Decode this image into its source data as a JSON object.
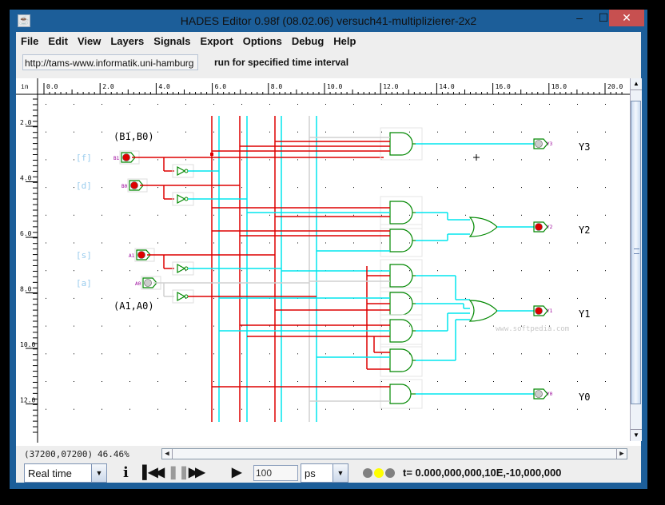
{
  "window": {
    "title": "HADES Editor 0.98f (08.02.06)   versuch41-multiplizierer-2x2",
    "controls": {
      "minimize": "‒",
      "maximize": "☐",
      "close": "✕"
    }
  },
  "menu": [
    "File",
    "Edit",
    "View",
    "Layers",
    "Signals",
    "Export",
    "Options",
    "Debug",
    "Help"
  ],
  "urlbar": {
    "url": "http://tams-www.informatik.uni-hamburg",
    "run_label": "run for specified time interval"
  },
  "ruler": {
    "unit": "in",
    "x_ticks": [
      "0.0",
      "2.0",
      "4.0",
      "6.0",
      "8.0",
      "10.0",
      "12.0",
      "14.0",
      "16.0",
      "18.0",
      "20.0"
    ],
    "y_ticks": [
      "2.0",
      "4.0",
      "6.0",
      "8.0",
      "10.0",
      "12.0"
    ]
  },
  "schematic": {
    "group_labels": {
      "b": "(B1,B0)",
      "a": "(A1,A0)"
    },
    "key_labels": [
      "[f]",
      "[d]",
      "[s]",
      "[a]"
    ],
    "inputs": [
      {
        "name": "B1",
        "tag": "B1",
        "value": 1
      },
      {
        "name": "B0",
        "tag": "B0",
        "value": 1
      },
      {
        "name": "A1",
        "tag": "A1",
        "value": 1
      },
      {
        "name": "A0",
        "tag": "A0",
        "value": 0
      }
    ],
    "outputs": [
      {
        "name": "Y3",
        "tag": "Y3",
        "value": 0
      },
      {
        "name": "Y2",
        "tag": "Y2",
        "value": 1
      },
      {
        "name": "Y1",
        "tag": "Y1",
        "value": 1
      },
      {
        "name": "Y0",
        "tag": "Y0",
        "value": 0
      }
    ],
    "colors": {
      "high": "#dd0000",
      "low": "#00e5ee",
      "undef": "#d0d0d0",
      "gate": "#008800",
      "label": "#99ccee",
      "port_tag": "#990099"
    },
    "watermark": "www.softpedia.com"
  },
  "status": {
    "coords": "(37200,07200)",
    "zoom": "46.46%"
  },
  "toolbar": {
    "mode": "Real time",
    "info_icon": "i",
    "run_time": "100",
    "unit": "ps",
    "time_display": "t= 0.000,000,000,10E,-10,000,000",
    "leds": [
      "#808080",
      "#ffff00",
      "#808080"
    ]
  }
}
